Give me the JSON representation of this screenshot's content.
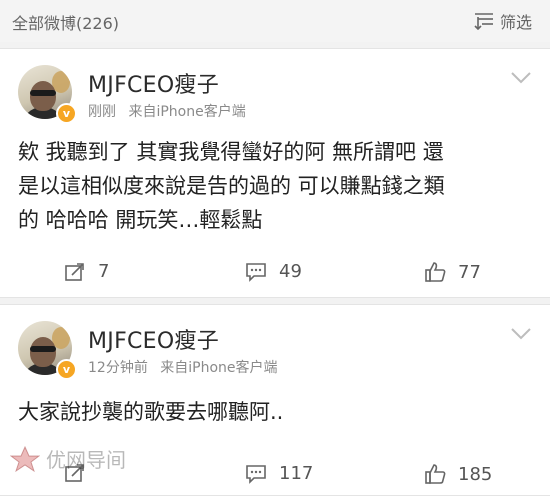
{
  "topbar": {
    "count_label": "全部微博(226)",
    "filter_label": "筛选"
  },
  "posts": [
    {
      "username": "MJFCEO瘦子",
      "time": "刚刚",
      "source": "来自iPhone客户端",
      "text_lines": [
        "欸 我聽到了 其實我覺得蠻好的阿 無所謂吧 還",
        "是以這相似度來說是告的過的 可以賺點錢之類",
        "的 哈哈哈 開玩笑…輕鬆點"
      ],
      "reposts": "7",
      "comments": "49",
      "likes": "77"
    },
    {
      "username": "MJFCEO瘦子",
      "time": "12分钟前",
      "source": "来自iPhone客户端",
      "text_lines": [
        "大家說抄襲的歌要去哪聽阿.."
      ],
      "reposts": "",
      "comments": "117",
      "likes": "185"
    }
  ],
  "watermark": {
    "text": "优网导间"
  },
  "colors": {
    "background": "#f2f2f2",
    "card": "#ffffff",
    "verified_badge": "#f6a623",
    "meta_text": "#8a8a8a"
  },
  "icons": {
    "filter": "filter-icon",
    "chevron": "chevron-down-icon",
    "repost": "repost-icon",
    "comment": "comment-icon",
    "like": "thumbs-up-icon",
    "verified": "verified-badge-icon"
  }
}
